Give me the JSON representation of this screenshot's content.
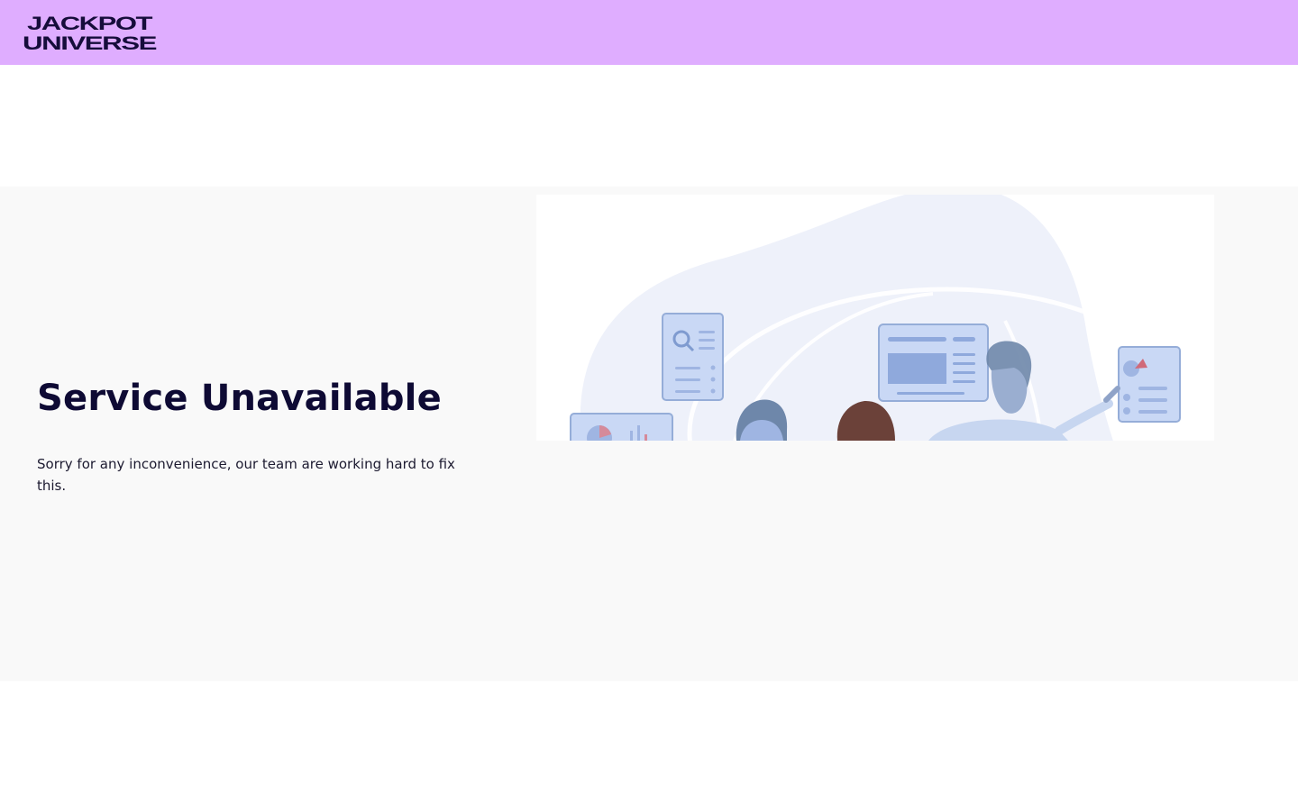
{
  "header": {
    "logo": {
      "line1": "JACKPOT",
      "line2": "UNIVERSE",
      "background": "#dfadff",
      "color": "#160d3b"
    }
  },
  "main": {
    "title": "Service Unavailable",
    "description": "Sorry for any inconvenience, our team are working hard to fix this.",
    "illustration": {
      "icon": "team-working-illustration-icon"
    }
  }
}
